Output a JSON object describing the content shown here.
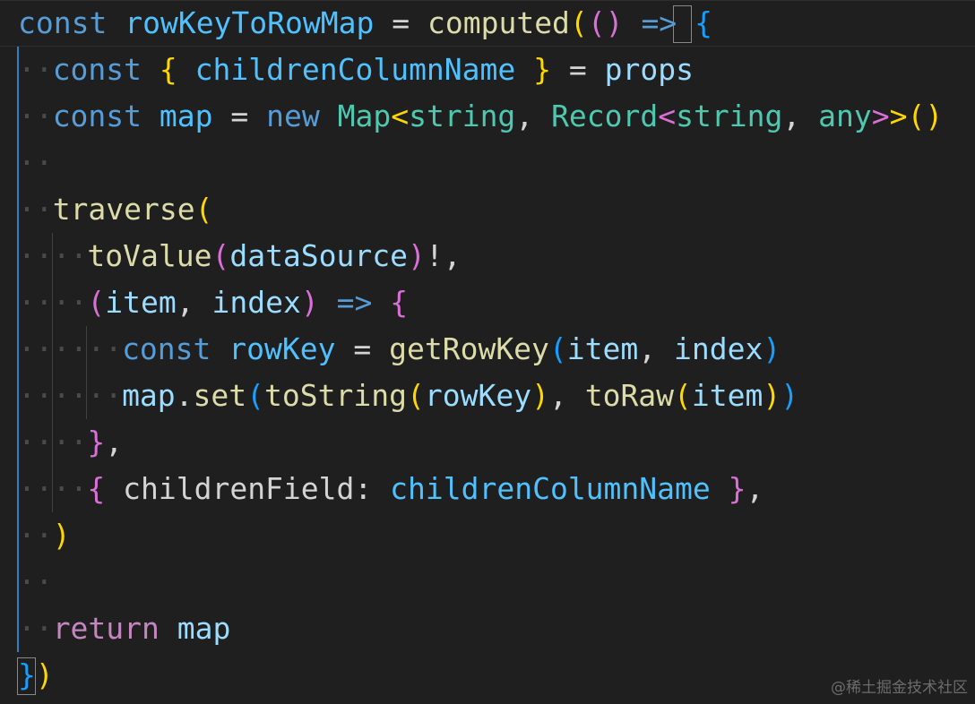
{
  "editor": {
    "theme": {
      "background": "#1f1f1f",
      "keyword_storage": "#569cd6",
      "keyword_control": "#c586c0",
      "variable": "#9cdcfe",
      "constant": "#4fc1ff",
      "function": "#dcdcaa",
      "type": "#4ec9b0",
      "plain": "#d4d4d4",
      "bracket_level1": "#ffd700",
      "bracket_level2": "#da70d6",
      "bracket_level3": "#179fff",
      "indent_guide": "#404040",
      "active_indent_guide": "#2f7fc4",
      "whitespace_dot": "#4a4a4a"
    },
    "lines": [
      {
        "indent": 0,
        "tokens": [
          {
            "t": "const",
            "c": "#569cd6"
          },
          {
            "t": " ",
            "c": "#d4d4d4"
          },
          {
            "t": "rowKeyToRowMap",
            "c": "#4fc1ff"
          },
          {
            "t": " = ",
            "c": "#d4d4d4"
          },
          {
            "t": "computed",
            "c": "#dcdcaa"
          },
          {
            "t": "(",
            "c": "#ffd700"
          },
          {
            "t": "()",
            "c": "#da70d6"
          },
          {
            "t": " ",
            "c": "#d4d4d4"
          },
          {
            "t": "=>",
            "c": "#569cd6"
          },
          {
            "t": " ",
            "c": "#d4d4d4"
          },
          {
            "t": "{",
            "c": "#179fff"
          }
        ]
      },
      {
        "indent": 1,
        "tokens": [
          {
            "t": "const",
            "c": "#569cd6"
          },
          {
            "t": " ",
            "c": "#d4d4d4"
          },
          {
            "t": "{",
            "c": "#ffd700"
          },
          {
            "t": " ",
            "c": "#d4d4d4"
          },
          {
            "t": "childrenColumnName",
            "c": "#4fc1ff"
          },
          {
            "t": " ",
            "c": "#d4d4d4"
          },
          {
            "t": "}",
            "c": "#ffd700"
          },
          {
            "t": " = ",
            "c": "#d4d4d4"
          },
          {
            "t": "props",
            "c": "#9cdcfe"
          }
        ]
      },
      {
        "indent": 1,
        "tokens": [
          {
            "t": "const",
            "c": "#569cd6"
          },
          {
            "t": " ",
            "c": "#d4d4d4"
          },
          {
            "t": "map",
            "c": "#4fc1ff"
          },
          {
            "t": " = ",
            "c": "#d4d4d4"
          },
          {
            "t": "new",
            "c": "#569cd6"
          },
          {
            "t": " ",
            "c": "#d4d4d4"
          },
          {
            "t": "Map",
            "c": "#4ec9b0"
          },
          {
            "t": "<",
            "c": "#ffd700"
          },
          {
            "t": "string",
            "c": "#4ec9b0"
          },
          {
            "t": ", ",
            "c": "#d4d4d4"
          },
          {
            "t": "Record",
            "c": "#4ec9b0"
          },
          {
            "t": "<",
            "c": "#da70d6"
          },
          {
            "t": "string",
            "c": "#4ec9b0"
          },
          {
            "t": ", ",
            "c": "#d4d4d4"
          },
          {
            "t": "any",
            "c": "#4ec9b0"
          },
          {
            "t": ">",
            "c": "#da70d6"
          },
          {
            "t": ">",
            "c": "#ffd700"
          },
          {
            "t": "()",
            "c": "#ffd700"
          }
        ]
      },
      {
        "indent": 1,
        "tokens": []
      },
      {
        "indent": 1,
        "tokens": [
          {
            "t": "traverse",
            "c": "#dcdcaa"
          },
          {
            "t": "(",
            "c": "#ffd700"
          }
        ]
      },
      {
        "indent": 2,
        "tokens": [
          {
            "t": "toValue",
            "c": "#dcdcaa"
          },
          {
            "t": "(",
            "c": "#da70d6"
          },
          {
            "t": "dataSource",
            "c": "#9cdcfe"
          },
          {
            "t": ")",
            "c": "#da70d6"
          },
          {
            "t": "!,",
            "c": "#d4d4d4"
          }
        ]
      },
      {
        "indent": 2,
        "tokens": [
          {
            "t": "(",
            "c": "#da70d6"
          },
          {
            "t": "item",
            "c": "#9cdcfe"
          },
          {
            "t": ", ",
            "c": "#d4d4d4"
          },
          {
            "t": "index",
            "c": "#9cdcfe"
          },
          {
            "t": ")",
            "c": "#da70d6"
          },
          {
            "t": " ",
            "c": "#d4d4d4"
          },
          {
            "t": "=>",
            "c": "#569cd6"
          },
          {
            "t": " ",
            "c": "#d4d4d4"
          },
          {
            "t": "{",
            "c": "#da70d6"
          }
        ]
      },
      {
        "indent": 3,
        "tokens": [
          {
            "t": "const",
            "c": "#569cd6"
          },
          {
            "t": " ",
            "c": "#d4d4d4"
          },
          {
            "t": "rowKey",
            "c": "#4fc1ff"
          },
          {
            "t": " = ",
            "c": "#d4d4d4"
          },
          {
            "t": "getRowKey",
            "c": "#dcdcaa"
          },
          {
            "t": "(",
            "c": "#179fff"
          },
          {
            "t": "item",
            "c": "#9cdcfe"
          },
          {
            "t": ", ",
            "c": "#d4d4d4"
          },
          {
            "t": "index",
            "c": "#9cdcfe"
          },
          {
            "t": ")",
            "c": "#179fff"
          }
        ]
      },
      {
        "indent": 3,
        "tokens": [
          {
            "t": "map",
            "c": "#9cdcfe"
          },
          {
            "t": ".",
            "c": "#d4d4d4"
          },
          {
            "t": "set",
            "c": "#dcdcaa"
          },
          {
            "t": "(",
            "c": "#179fff"
          },
          {
            "t": "toString",
            "c": "#dcdcaa"
          },
          {
            "t": "(",
            "c": "#ffd700"
          },
          {
            "t": "rowKey",
            "c": "#9cdcfe"
          },
          {
            "t": ")",
            "c": "#ffd700"
          },
          {
            "t": ", ",
            "c": "#d4d4d4"
          },
          {
            "t": "toRaw",
            "c": "#dcdcaa"
          },
          {
            "t": "(",
            "c": "#ffd700"
          },
          {
            "t": "item",
            "c": "#9cdcfe"
          },
          {
            "t": ")",
            "c": "#ffd700"
          },
          {
            "t": ")",
            "c": "#179fff"
          }
        ]
      },
      {
        "indent": 2,
        "tokens": [
          {
            "t": "}",
            "c": "#da70d6"
          },
          {
            "t": ",",
            "c": "#d4d4d4"
          }
        ]
      },
      {
        "indent": 2,
        "tokens": [
          {
            "t": "{",
            "c": "#da70d6"
          },
          {
            "t": " childrenField: ",
            "c": "#d4d4d4"
          },
          {
            "t": "childrenColumnName",
            "c": "#4fc1ff"
          },
          {
            "t": " ",
            "c": "#d4d4d4"
          },
          {
            "t": "}",
            "c": "#da70d6"
          },
          {
            "t": ",",
            "c": "#d4d4d4"
          }
        ]
      },
      {
        "indent": 1,
        "tokens": [
          {
            "t": ")",
            "c": "#ffd700"
          }
        ]
      },
      {
        "indent": 1,
        "tokens": []
      },
      {
        "indent": 1,
        "tokens": [
          {
            "t": "return",
            "c": "#c586c0"
          },
          {
            "t": " ",
            "c": "#d4d4d4"
          },
          {
            "t": "map",
            "c": "#9cdcfe"
          }
        ]
      },
      {
        "indent": 0,
        "tokens": [
          {
            "t": "}",
            "c": "#179fff"
          },
          {
            "t": ")",
            "c": "#ffd700"
          }
        ]
      }
    ]
  },
  "watermark": "@稀土掘金技术社区"
}
